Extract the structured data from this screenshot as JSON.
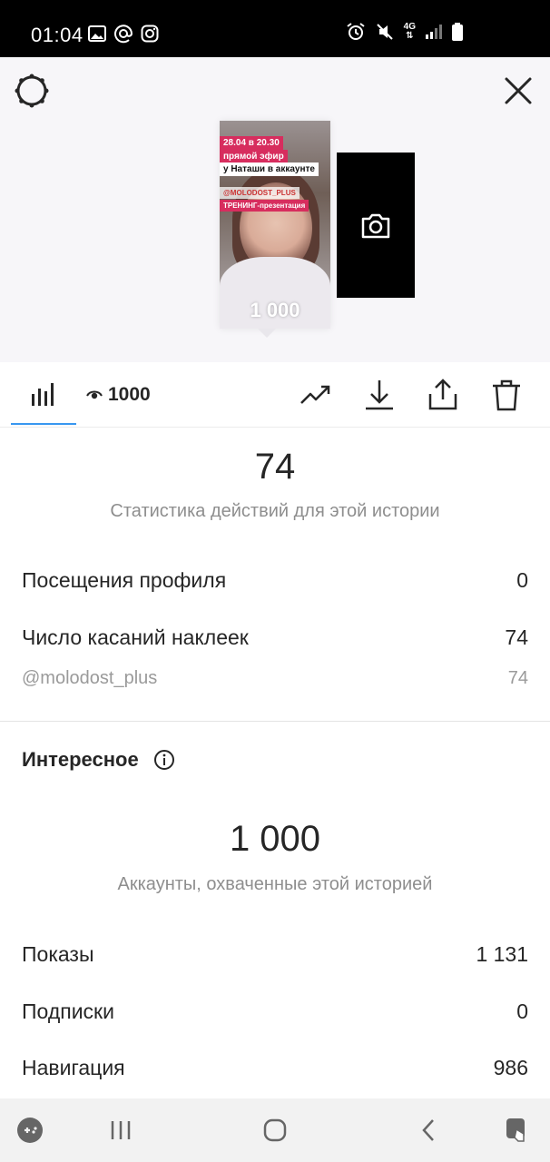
{
  "status_bar": {
    "time": "01:04",
    "left_icons": [
      "image-icon",
      "at-icon",
      "instagram-icon"
    ],
    "right_icons": [
      "alarm-icon",
      "mute-icon",
      "network-4g-icon",
      "signal-icon",
      "battery-icon"
    ],
    "network_label": "4G"
  },
  "story": {
    "tags": [
      "28.04 в 20.30",
      "прямой эфир",
      "у Наташи в аккаунте",
      "@MOLODOST_PLUS",
      "ТРЕНИНГ-презентация"
    ],
    "count_overlay": "1 000",
    "next_story_icon": "camera-icon"
  },
  "header": {
    "settings_icon": "gear-icon",
    "close_icon": "close-icon"
  },
  "toolbar": {
    "views_count": "1000",
    "icons": [
      "bar-chart-icon",
      "eye-icon",
      "trending-icon",
      "download-icon",
      "share-icon",
      "trash-icon"
    ]
  },
  "actions": {
    "value": "74",
    "caption": "Статистика действий для этой истории",
    "rows": [
      {
        "label": "Посещения профиля",
        "value": "0"
      },
      {
        "label": "Число касаний наклеек",
        "value": "74"
      },
      {
        "label": "@molodost_plus",
        "value": "74"
      }
    ]
  },
  "discovery": {
    "title": "Интересное",
    "info_icon": "info-icon",
    "value": "1 000",
    "caption": "Аккаунты, охваченные этой историей",
    "rows": [
      {
        "label": "Показы",
        "value": "1 131"
      },
      {
        "label": "Подписки",
        "value": "0"
      },
      {
        "label": "Навигация",
        "value": "986"
      }
    ]
  },
  "nav_bar": {
    "icons": [
      "game-launcher-icon",
      "recent-apps-icon",
      "home-icon",
      "back-icon",
      "screenshot-icon"
    ]
  }
}
